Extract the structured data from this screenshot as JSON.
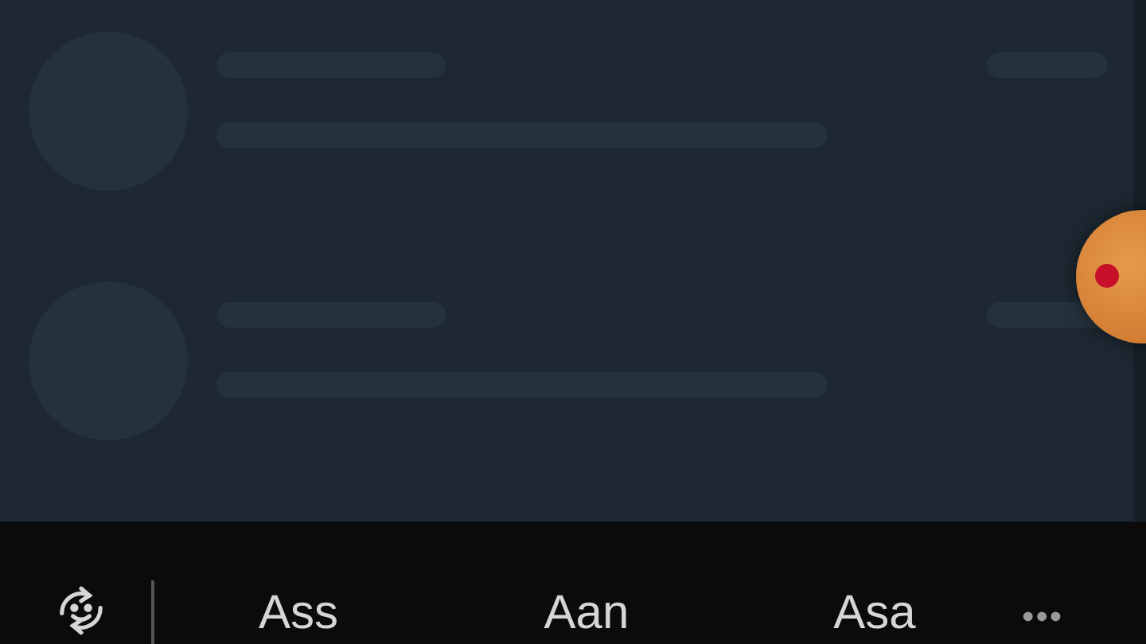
{
  "list": {
    "rows": [
      {
        "kind": "skeleton"
      },
      {
        "kind": "skeleton"
      }
    ]
  },
  "suggestion_bar": {
    "suggestions": [
      "Ass",
      "Aan",
      "Asa"
    ],
    "more": "•••"
  }
}
